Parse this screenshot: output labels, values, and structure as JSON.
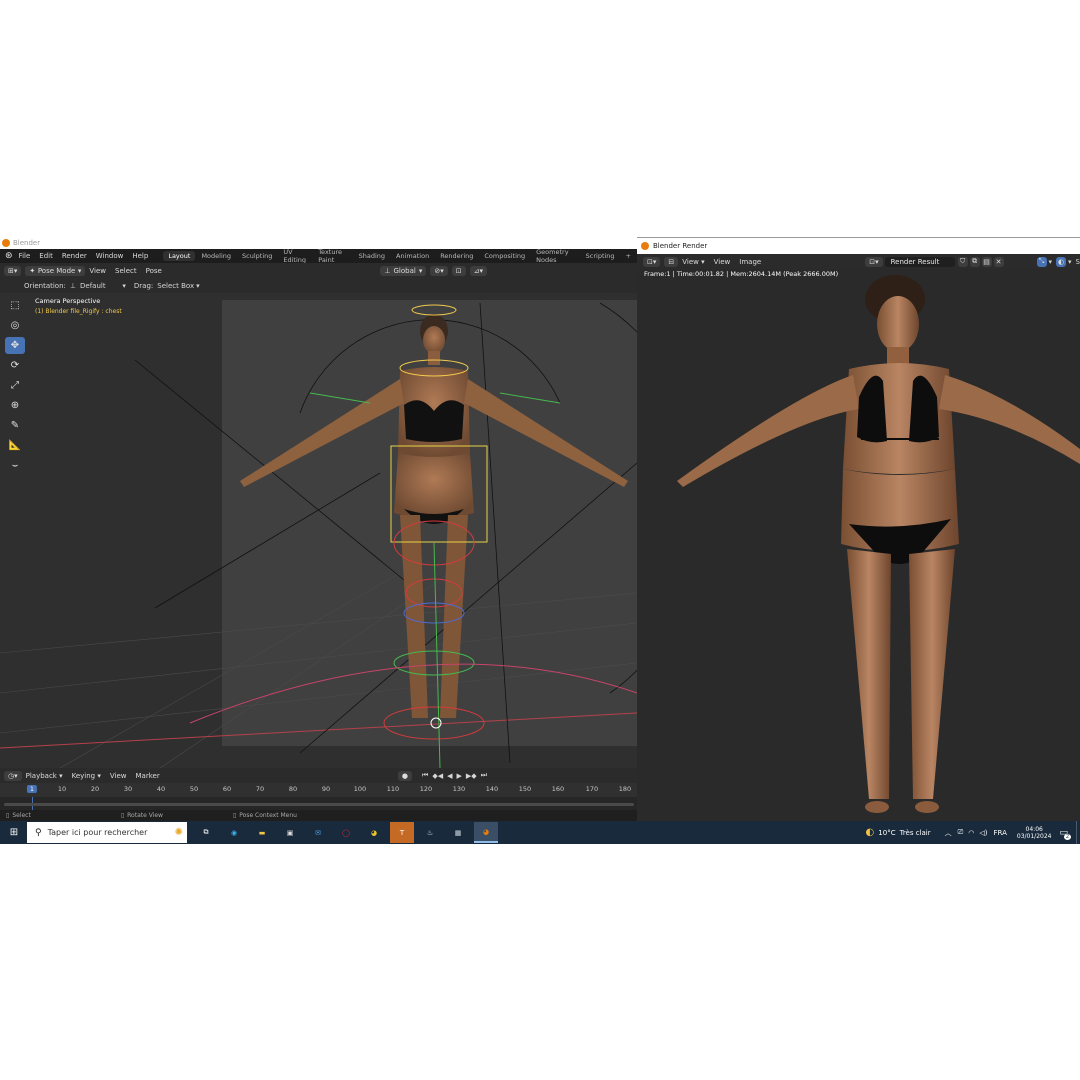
{
  "main_window": {
    "title": "Blender",
    "menus": [
      "File",
      "Edit",
      "Render",
      "Window",
      "Help"
    ],
    "workspaces": [
      {
        "label": "Layout",
        "active": true
      },
      {
        "label": "Modeling",
        "active": false
      },
      {
        "label": "Sculpting",
        "active": false
      },
      {
        "label": "UV Editing",
        "active": false
      },
      {
        "label": "Texture Paint",
        "active": false
      },
      {
        "label": "Shading",
        "active": false
      },
      {
        "label": "Animation",
        "active": false
      },
      {
        "label": "Rendering",
        "active": false
      },
      {
        "label": "Compositing",
        "active": false
      },
      {
        "label": "Geometry Nodes",
        "active": false
      },
      {
        "label": "Scripting",
        "active": false
      }
    ],
    "add_workspace": "+",
    "header": {
      "mode": "Pose Mode",
      "menus": [
        "View",
        "Select",
        "Pose"
      ],
      "transform_space": "Global"
    },
    "options": {
      "orientation_label": "Orientation:",
      "orientation_value": "Default",
      "drag_label": "Drag:",
      "drag_value": "Select Box"
    },
    "viewport": {
      "view_name": "Camera Perspective",
      "object_info": "(1) Blender file_Rigify : chest"
    },
    "timeline": {
      "menus": [
        "Playback",
        "Keying",
        "View",
        "Marker"
      ],
      "current_frame": 1,
      "ticks": [
        "10",
        "20",
        "30",
        "40",
        "50",
        "60",
        "70",
        "80",
        "90",
        "100",
        "110",
        "120",
        "130",
        "140",
        "150",
        "160",
        "170",
        "180"
      ]
    },
    "status": {
      "select": "Select",
      "rotate": "Rotate View",
      "context": "Pose Context Menu"
    }
  },
  "render_window": {
    "title": "Blender Render",
    "menus": [
      "View",
      "View",
      "Image"
    ],
    "image_name": "Render Result",
    "stats": "Frame:1 | Time:00:01.82 | Mem:2604.14M (Peak 2666.00M)"
  },
  "taskbar": {
    "search_placeholder": "Taper ici pour rechercher",
    "weather_temp": "10°C",
    "weather_desc": "Très clair",
    "language": "FRA",
    "time": "04:06",
    "date": "03/01/2024",
    "notification_count": "2"
  },
  "colors": {
    "accent_blue": "#4772b3",
    "viewport_bg": "#3b3b3b",
    "render_bg": "#2a2a2a",
    "taskbar_bg": "#182a3c",
    "blender_orange": "#e87d0d",
    "info_yellow": "#f2c94c"
  }
}
